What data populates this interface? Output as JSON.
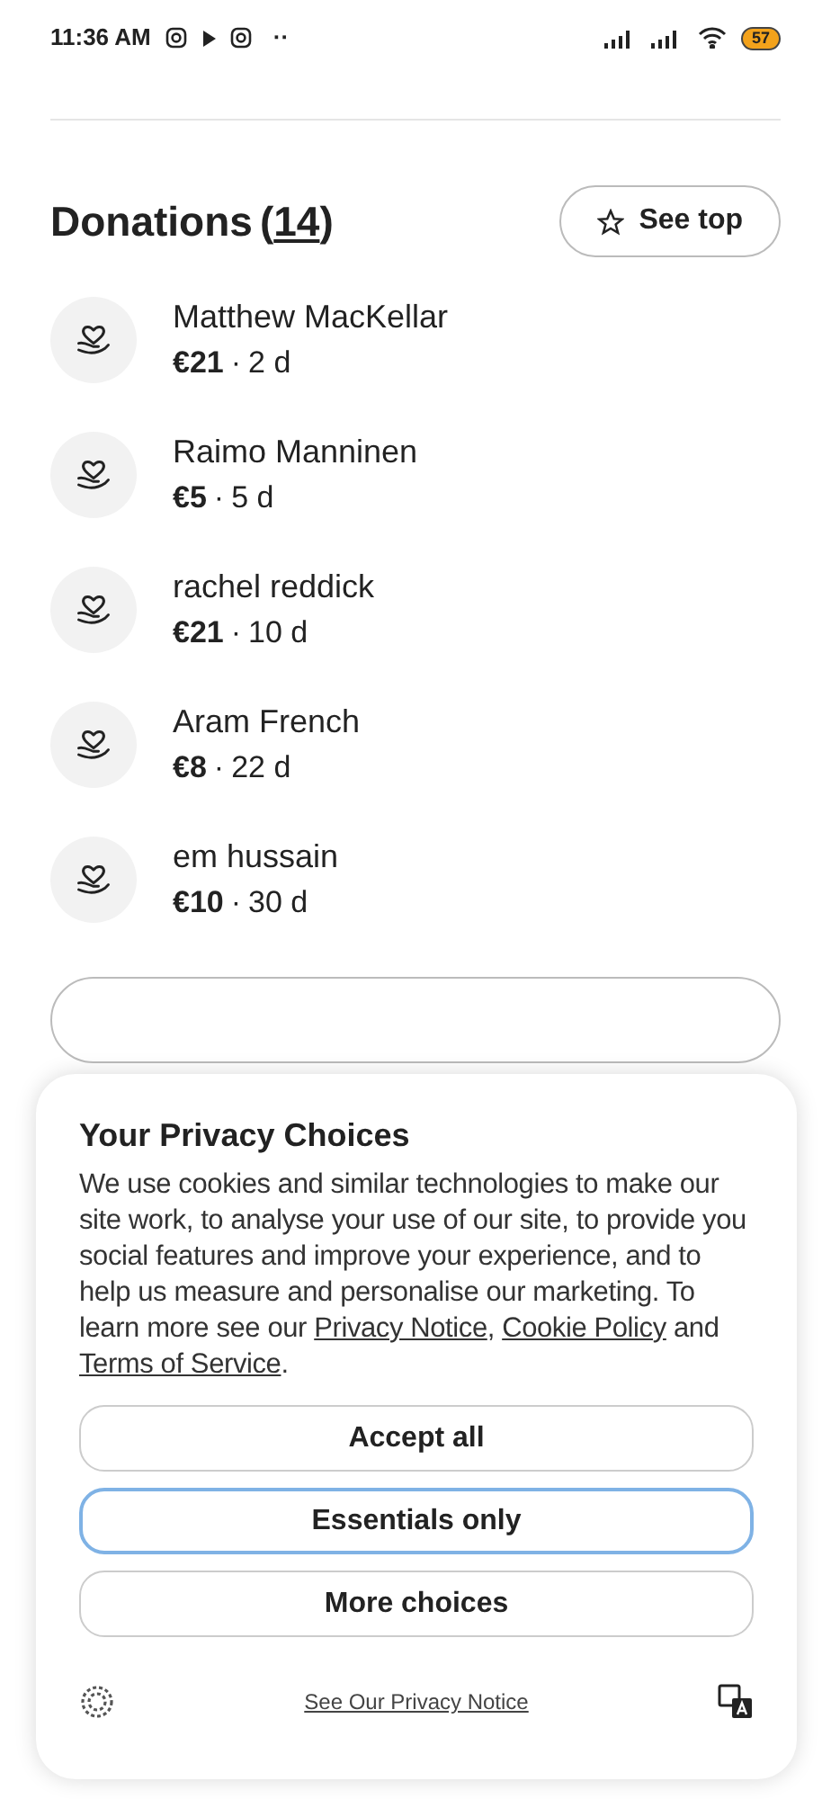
{
  "status_bar": {
    "time": "11:36 AM",
    "overflow": "··",
    "battery": "57"
  },
  "donations": {
    "title": "Donations",
    "count_open": "(",
    "count": "14",
    "count_close": ")",
    "see_top": "See top",
    "items": [
      {
        "name": "Matthew MacKellar",
        "amount": "€21",
        "separator": "·",
        "age": "2 d"
      },
      {
        "name": "Raimo Manninen",
        "amount": "€5",
        "separator": "·",
        "age": "5 d"
      },
      {
        "name": "rachel reddick",
        "amount": "€21",
        "separator": "·",
        "age": "10 d"
      },
      {
        "name": "Aram French",
        "amount": "€8",
        "separator": "·",
        "age": "22 d"
      },
      {
        "name": "em hussain",
        "amount": "€10",
        "separator": "·",
        "age": "30 d"
      }
    ]
  },
  "privacy_dialog": {
    "title": "Your Privacy Choices",
    "body": [
      {
        "kind": "text",
        "text": "We use cookies and similar technologies to make our site work, to analyse your use of our site, to provide you social features and improve your experience, and to help us measure and personalise our marketing. To learn more see our "
      },
      {
        "kind": "link",
        "text": "Privacy Notice"
      },
      {
        "kind": "text",
        "text": ", "
      },
      {
        "kind": "link",
        "text": "Cookie Policy"
      },
      {
        "kind": "text",
        "text": " and "
      },
      {
        "kind": "link",
        "text": "Terms of Service"
      },
      {
        "kind": "text",
        "text": "."
      }
    ],
    "buttons": [
      {
        "label": "Accept all",
        "focused": false
      },
      {
        "label": "Essentials only",
        "focused": true
      },
      {
        "label": "More choices",
        "focused": false
      }
    ],
    "footer_link": "See Our Privacy Notice"
  }
}
